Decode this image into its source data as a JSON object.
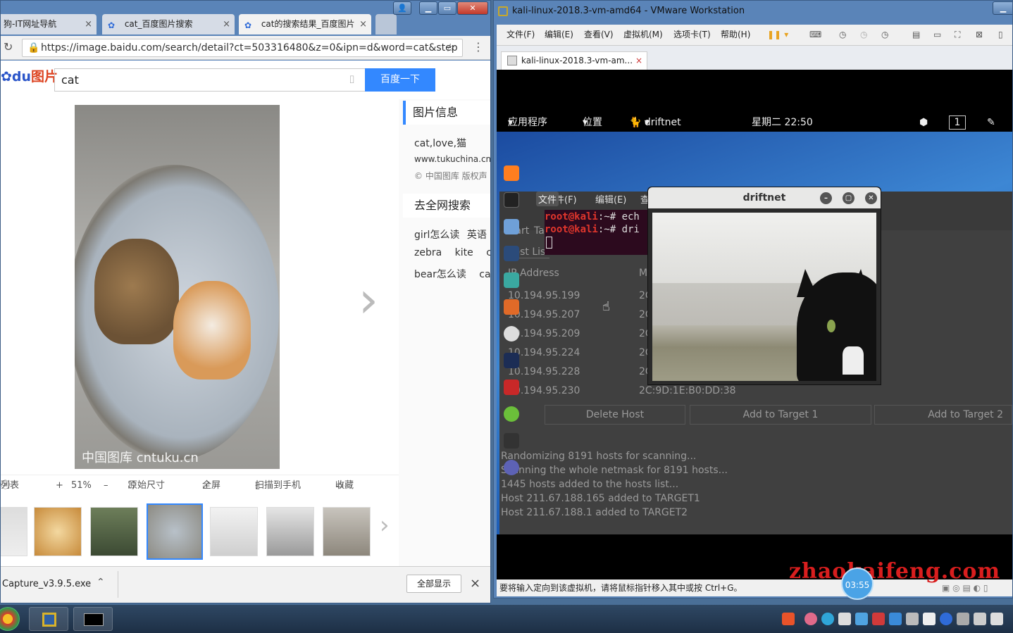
{
  "chrome": {
    "tabs": [
      {
        "label": "狗-IT网址导航",
        "close": "×"
      },
      {
        "label": "cat_百度图片搜索",
        "close": "×"
      },
      {
        "label": "cat的搜索结果_百度图片",
        "close": "×"
      }
    ],
    "url": "https://image.baidu.com/search/detail?ct=503316480&z=0&ipn=d&word=cat&step",
    "logo_text": "图片",
    "search_value": "cat",
    "search_button": "百度一下",
    "image_watermark": "中国图库 cntuku.cn",
    "side": {
      "info_title": "图片信息",
      "info_tags": "cat,love,猫",
      "info_site": "www.tukuchina.cn",
      "info_copyright": "© 中国图库 版权声",
      "search_title": "去全网搜索",
      "related": [
        [
          "girl怎么读",
          "英语"
        ],
        [
          "zebra",
          "kite",
          "ca"
        ],
        [
          "bear怎么读",
          "cat"
        ]
      ]
    },
    "toolbar": {
      "list": "列表",
      "zoom_in": "+",
      "zoom": "51%",
      "zoom_out": "–",
      "original": "原始尺寸",
      "fullscreen": "全屏",
      "scan": "扫描到手机",
      "collect": "收藏"
    },
    "download": {
      "filename": "Capture_v3.9.5.exe",
      "show_all": "全部显示",
      "close": "×"
    }
  },
  "vmware": {
    "title": "kali-linux-2018.3-vm-amd64 - VMware Workstation",
    "menu": [
      "文件(F)",
      "编辑(E)",
      "查看(V)",
      "虚拟机(M)",
      "选项卡(T)",
      "帮助(H)"
    ],
    "tab_label": "kali-linux-2018.3-vm-am...",
    "tab_close": "×",
    "status": "要将输入定向到该虚拟机，请将鼠标指针移入其中或按 Ctrl+G。",
    "guest": {
      "apps_menu": "应用程序",
      "places_menu": "位置",
      "app_name": "driftnet",
      "clock": "星期二 22:50",
      "workspace": "1",
      "ettercap": {
        "start": "Start",
        "targets": "Ta",
        "host_list_tab": "Host List",
        "col_ip": "IP Address",
        "col_mac": "M",
        "hosts": [
          {
            "ip": "10.194.95.199",
            "mac": "2C"
          },
          {
            "ip": "10.194.95.207",
            "mac": "2C"
          },
          {
            "ip": "10.194.95.209",
            "mac": "2C"
          },
          {
            "ip": "10.194.95.224",
            "mac": "2C"
          },
          {
            "ip": "10.194.95.228",
            "mac": "2C"
          },
          {
            "ip": "10.194.95.230",
            "mac": "2C:9D:1E:B0:DD:38"
          }
        ],
        "delete_host": "Delete Host",
        "add_t1": "Add to Target 1",
        "add_t2": "Add to Target 2",
        "log": [
          "Randomizing 8191 hosts for scanning...",
          "Scanning the whole netmask for 8191 hosts...",
          "1445 hosts added to the hosts list...",
          "Host 211.67.188.165 added to TARGET1",
          "Host 211.67.188.1 added to TARGET2"
        ]
      },
      "terminal": {
        "menu_file": "文件(F)",
        "menu_edit": "编辑(E)",
        "menu_view": "查",
        "tooltip": "文件",
        "line1_prompt": "root@kali",
        "line1_rest": ":~# ech",
        "line2_prompt": "root@kali",
        "line2_rest": ":~# dri"
      },
      "driftnet_title": "driftnet"
    }
  },
  "overlay": {
    "site_watermark": "zhaokaifeng.com",
    "timer": "03:55"
  },
  "colors": {
    "baidu_blue": "#3388ff",
    "watermark_red": "#d91e1e",
    "term_prompt_red": "#e0362c"
  }
}
